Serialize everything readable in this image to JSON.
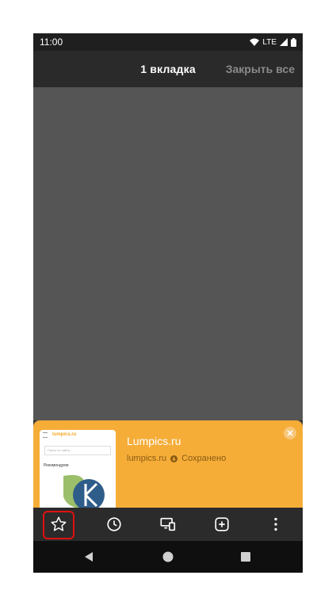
{
  "status": {
    "time": "11:00",
    "network": "LTE"
  },
  "header": {
    "tab_count": "1 вкладка",
    "close_all": "Закрыть все"
  },
  "card": {
    "title": "Lumpics.ru",
    "domain": "lumpics.ru",
    "saved": "Сохранено",
    "thumbnail": {
      "site": "lumpics.ru",
      "search_placeholder": "Поиск по сайту...",
      "section": "Рекомендуем"
    }
  },
  "toolbar": {
    "items": [
      "star-icon",
      "history-icon",
      "devices-icon",
      "new-tab-icon",
      "more-icon"
    ]
  },
  "colors": {
    "accent": "#f5ad38",
    "highlight": "#e01010"
  }
}
